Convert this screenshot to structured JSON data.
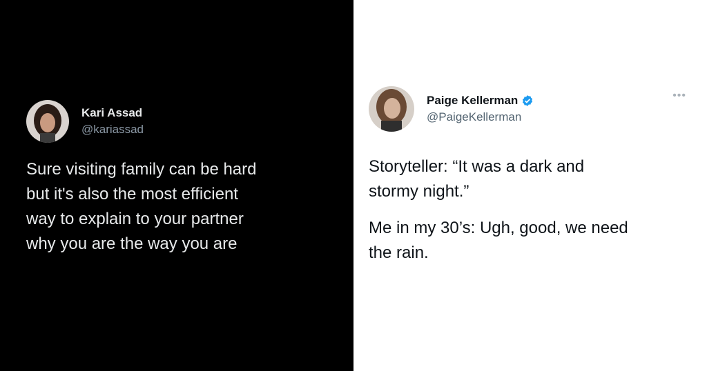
{
  "tweets": [
    {
      "name": "Kari Assad",
      "handle": "@kariassad",
      "text": "Sure visiting family can be hard\nbut it's also the most efficient\nway to explain to your partner\nwhy you are the way you are"
    },
    {
      "name": "Paige Kellerman",
      "handle": "@PaigeKellerman",
      "verified_icon": "verified-badge-icon",
      "more_icon": "more-options-icon",
      "text_paragraph_1": "Storyteller: “It was a dark and\nstormy night.”",
      "text_paragraph_2": "Me in my 30’s: Ugh, good, we need\nthe rain."
    }
  ],
  "colors": {
    "left_background": "#000000",
    "right_background": "#ffffff",
    "verified_blue": "#1d9bf0"
  }
}
